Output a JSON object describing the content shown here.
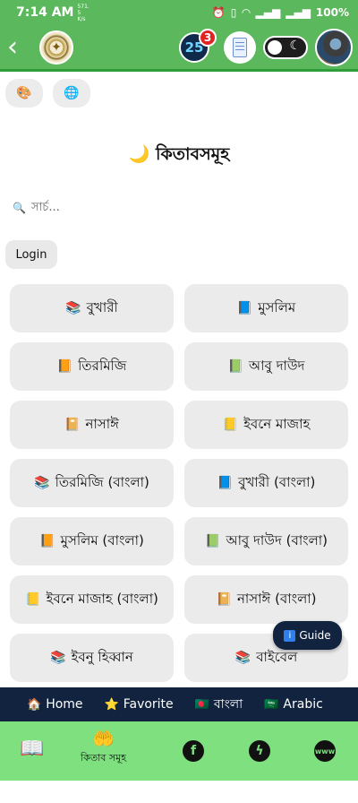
{
  "status_bar": {
    "time": "7:14 AM",
    "net_speed": "571.",
    "net_speed_2": "5",
    "net_unit": "K/s",
    "battery": "100%"
  },
  "app_bar": {
    "notification_count": "3",
    "clock_value": "25"
  },
  "page": {
    "title": "🌙 কিতাবসমূহ",
    "search_placeholder": "সার্চ...",
    "login_label": "Login",
    "theme_button": "🎨",
    "language_button": "🌐"
  },
  "books": [
    {
      "icon": "📚",
      "label": "বুখারী"
    },
    {
      "icon": "📘",
      "label": "মুসলিম"
    },
    {
      "icon": "📙",
      "label": "তিরমিজি"
    },
    {
      "icon": "📗",
      "label": "আবু দাউদ"
    },
    {
      "icon": "📔",
      "label": "নাসাঈ"
    },
    {
      "icon": "📒",
      "label": "ইবনে মাজাহ"
    },
    {
      "icon": "📚",
      "label": "তিরমিজি (বাংলা)"
    },
    {
      "icon": "📘",
      "label": "বুখারী (বাংলা)"
    },
    {
      "icon": "📙",
      "label": "মুসলিম (বাংলা)"
    },
    {
      "icon": "📗",
      "label": "আবু দাউদ (বাংলা)"
    },
    {
      "icon": "📒",
      "label": "ইবনে মাজাহ (বাংলা)"
    },
    {
      "icon": "📔",
      "label": "নাসাঈ (বাংলা)"
    },
    {
      "icon": "📚",
      "label": "ইবনু হিব্বান"
    },
    {
      "icon": "📚",
      "label": "বাইবেল"
    }
  ],
  "guide_label": "Guide",
  "nav": [
    {
      "icon": "🏠",
      "label": "Home"
    },
    {
      "icon": "⭐",
      "label": "Favorite"
    },
    {
      "icon": "🇧🇩",
      "label": "বাংলা"
    },
    {
      "icon": "🇸🇦",
      "label": "Arabic"
    }
  ],
  "bottom_nav": {
    "books_label": "কিতাব সমূহ"
  },
  "colors": {
    "app_green": "#5cb85c",
    "bottom_green": "#7ee07e",
    "dark_navy": "#11233f",
    "badge_red": "#e02424"
  }
}
